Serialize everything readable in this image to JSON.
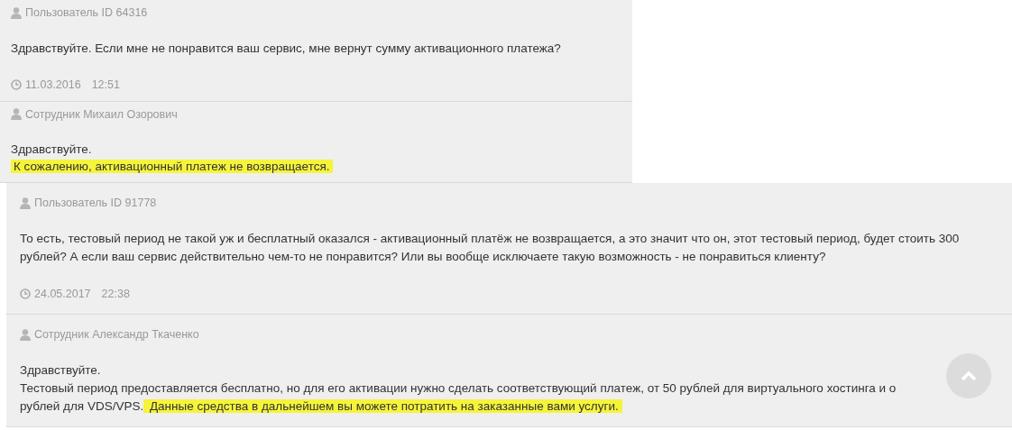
{
  "threads": [
    {
      "kind": "main",
      "messages": [
        {
          "author": "Пользователь ID 64316",
          "lines": [
            [
              {
                "text": "Здравствуйте. Если мне не понравится ваш сервис, мне вернут сумму активационного платежа?",
                "highlight": false
              }
            ]
          ],
          "date": "11.03.2016",
          "time": "12:51"
        },
        {
          "author": "Сотрудник Михаил Озорович",
          "lines": [
            [
              {
                "text": "Здравствуйте.",
                "highlight": false
              }
            ],
            [
              {
                "text": "К сожалению, активационный платеж не возвращается.",
                "highlight": true
              }
            ]
          ]
        }
      ]
    },
    {
      "kind": "reply",
      "messages": [
        {
          "author": "Пользователь ID 91778",
          "lines": [
            [
              {
                "text": "То есть, тестовый период не такой уж и бесплатный оказался - активационный платёж не возвращается, а это значит что он, этот тестовый период, будет стоить 300",
                "highlight": false
              }
            ],
            [
              {
                "text": "рублей? А если ваш сервис действительно чем-то не понравится? Или вы вообще исключаете такую возможность - не понравиться клиенту?",
                "highlight": false
              }
            ]
          ],
          "date": "24.05.2017",
          "time": "22:38"
        },
        {
          "author": "Сотрудник Александр Ткаченко",
          "lines": [
            [
              {
                "text": "Здравствуйте.",
                "highlight": false
              }
            ],
            [
              {
                "text": "Тестовый период предоставляется бесплатно, но для его активации нужно сделать соответствующий платеж, от 50 рублей для виртуального хостинга и о",
                "highlight": false
              }
            ],
            [
              {
                "text": "рублей для VDS/VPS.",
                "highlight": false
              },
              {
                "text": " Данные средства в дальнейшем вы можете потратить на заказанные вами услуги.",
                "highlight": true
              }
            ]
          ]
        }
      ]
    }
  ]
}
